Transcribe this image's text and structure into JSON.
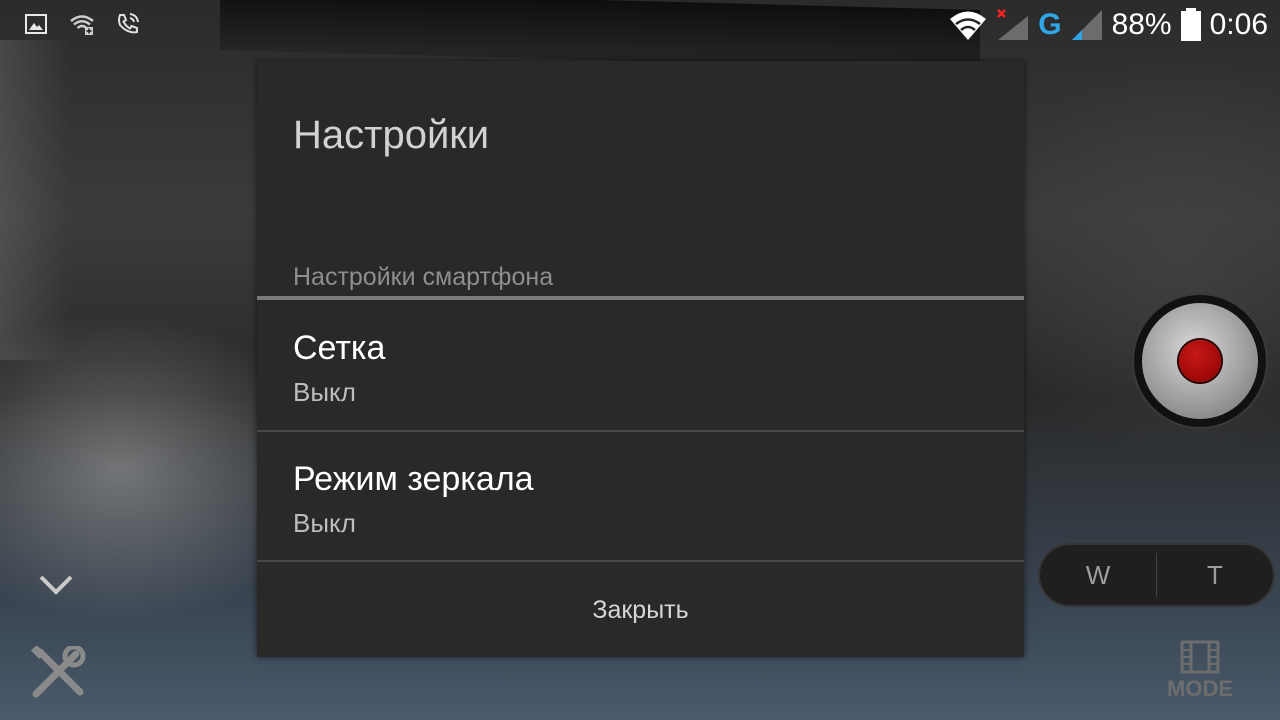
{
  "status_bar": {
    "battery": "88%",
    "time": "0:06",
    "network_type": "G",
    "icons": [
      "image-icon",
      "wifi-add-icon",
      "phone-wifi-call-icon",
      "wifi-icon",
      "signal-no-service-icon",
      "signal-icon",
      "battery-icon"
    ]
  },
  "dialog": {
    "title": "Настройки",
    "category": "Настройки смартфона",
    "items": [
      {
        "title": "Сетка",
        "summary": "Выкл"
      },
      {
        "title": "Режим зеркала",
        "summary": "Выкл"
      }
    ],
    "close_label": "Закрыть"
  },
  "camera": {
    "zoom_wide": "W",
    "zoom_tele": "T",
    "mode_label": "MODE",
    "accent_red": "#b01010",
    "network_color": "#2fa6e6"
  }
}
